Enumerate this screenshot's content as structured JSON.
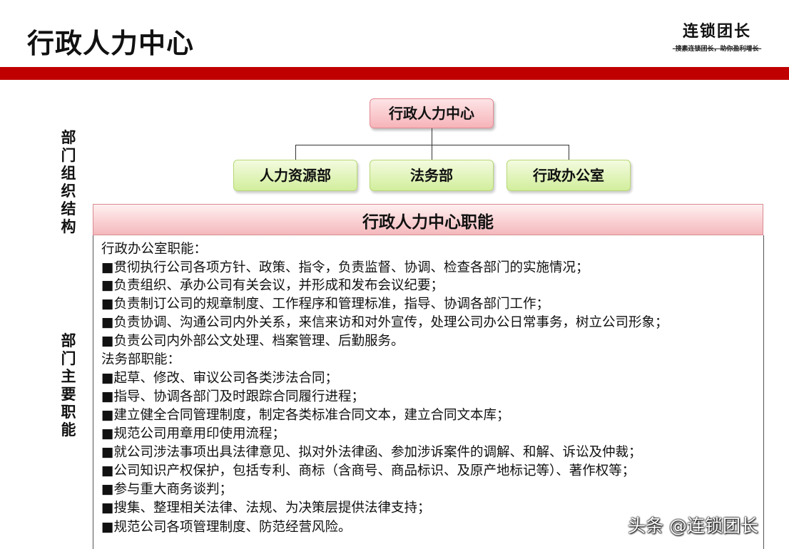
{
  "header": {
    "title": "行政人力中心",
    "brand_name": "连锁团长",
    "brand_slogan": "-搜素连锁团长，助你盈利增长-"
  },
  "side_labels": {
    "org": [
      "部",
      "门",
      "组",
      "织",
      "结",
      "构"
    ],
    "duties": [
      "部",
      "门",
      "主",
      "要",
      "职",
      "能"
    ]
  },
  "org_chart": {
    "root": "行政人力中心",
    "children": [
      "人力资源部",
      "法务部",
      "行政办公室"
    ]
  },
  "functions": {
    "title": "行政人力中心职能",
    "lines": [
      "行政办公室职能：",
      "■贯彻执行公司各项方针、政策、指令，负责监督、协调、检查各部门的实施情况；",
      "■负责组织、承办公司有关会议，并形成和发布会议纪要；",
      "■负责制订公司的规章制度、工作程序和管理标准，指导、协调各部门工作；",
      "■负责协调、沟通公司内外关系，来信来访和对外宣传，处理公司办公日常事务，树立公司形象；",
      "■负责公司内外部公文处理、档案管理、后勤服务。",
      "法务部职能：",
      "■起草、修改、审议公司各类涉法合同；",
      "■指导、协调各部门及时跟踪合同履行进程；",
      "■建立健全合同管理制度，制定各类标准合同文本，建立合同文本库；",
      "■规范公司用章用印使用流程；",
      "■就公司涉法事项出具法律意见、拟对外法律函、参加涉诉案件的调解、和解、诉讼及仲裁；",
      "■公司知识产权保护，包括专利、商标（含商号、商品标识、及原产地标记等）、著作权等；",
      "■参与重大商务谈判；",
      "■搜集、整理相关法律、法规、为决策层提供法律支持；",
      "■规范公司各项管理制度、防范经营风险。"
    ]
  },
  "watermark": "头条 @连锁团长"
}
